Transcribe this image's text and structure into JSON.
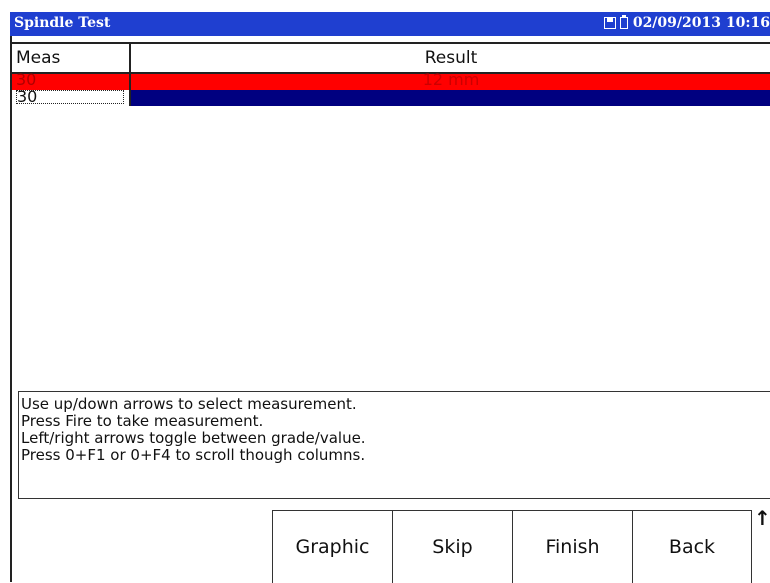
{
  "window": {
    "title": "Spindle Test",
    "datetime": "02/09/2013 10:16",
    "icons": [
      "sd-card-icon",
      "battery-icon"
    ]
  },
  "table": {
    "columns": [
      "Meas",
      "Result"
    ],
    "rows": [
      {
        "meas": "30",
        "result": "12 mm",
        "state": "highlighted-red"
      },
      {
        "meas": "30",
        "result": "",
        "state": "selected"
      }
    ]
  },
  "help": {
    "lines": [
      "Use up/down arrows to select measurement.",
      "Press Fire to take measurement.",
      "Left/right arrows toggle between grade/value.",
      "Press 0+F1 or 0+F4 to scroll though columns."
    ]
  },
  "softkeys": [
    "Graphic",
    "Skip",
    "Finish",
    "Back"
  ],
  "scroll_indicator": "↑",
  "colors": {
    "titlebar": "#1f3fd0",
    "row_highlight": "#ff0000",
    "row_selected": "#000080"
  }
}
